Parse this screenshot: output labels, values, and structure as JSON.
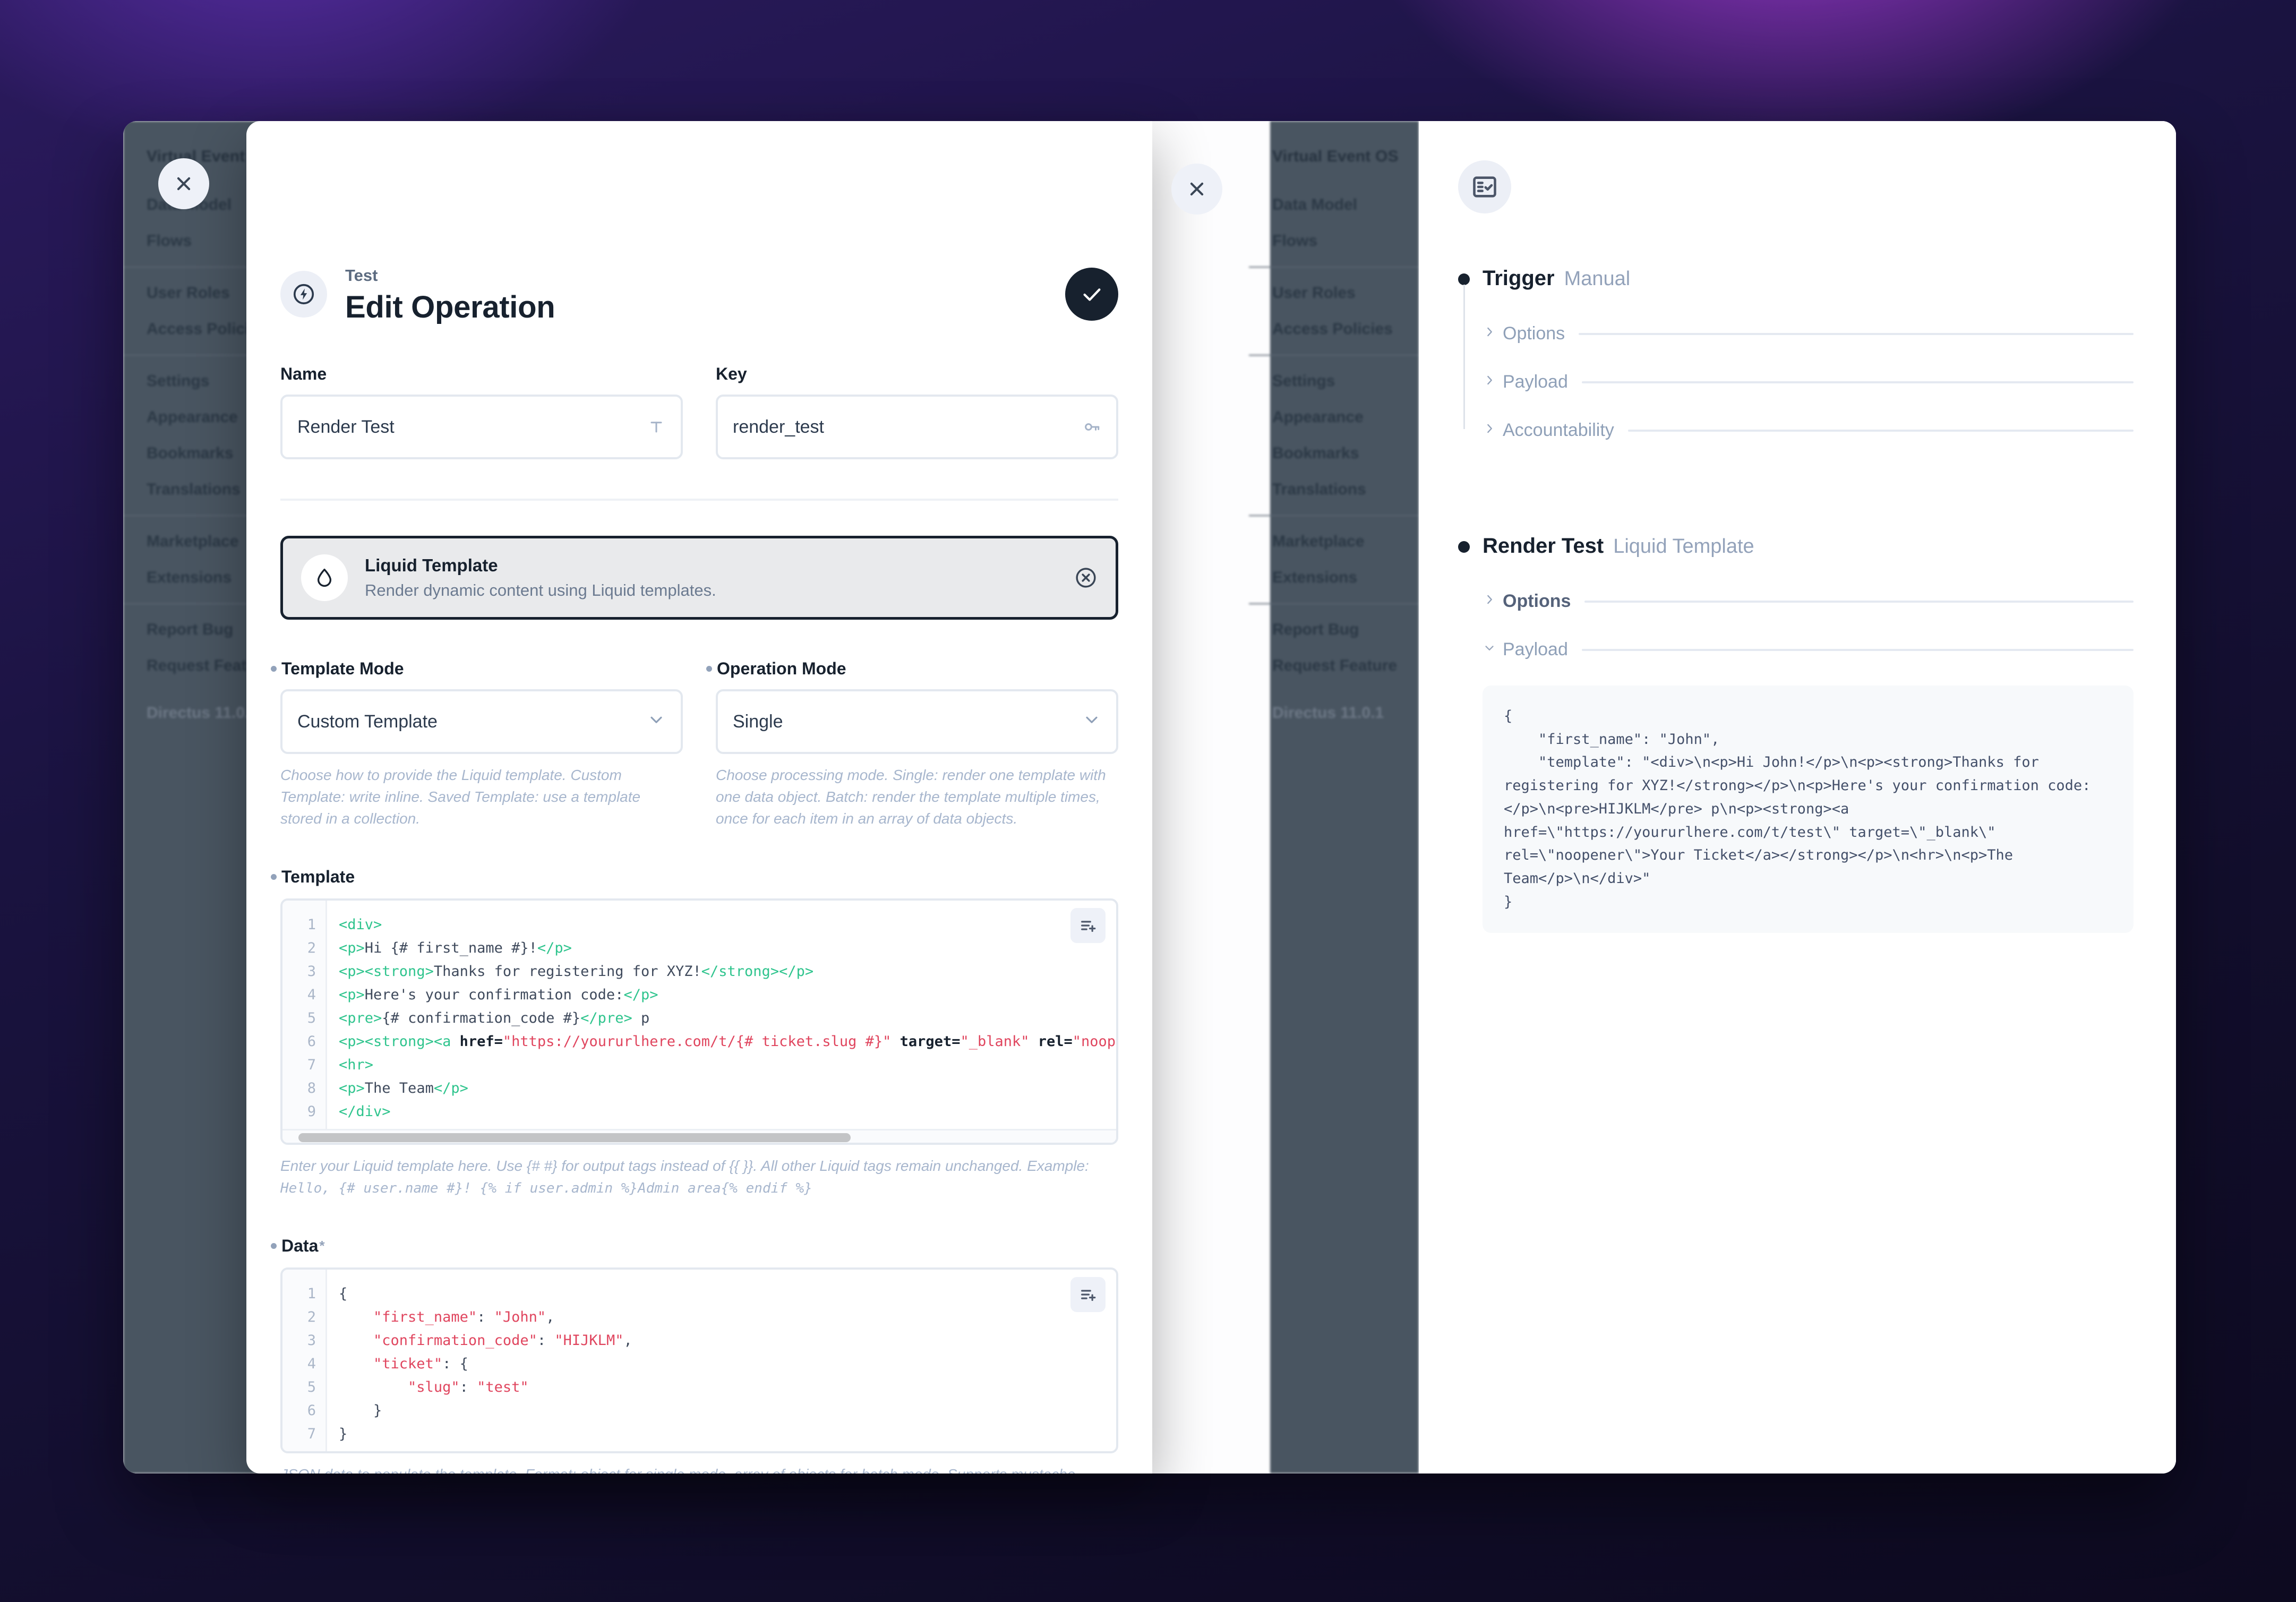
{
  "app": {
    "project_name": "Virtual Event OS",
    "version": "Directus 11.0.1",
    "sidebar_groups": [
      {
        "items": [
          "Data Model",
          "Flows"
        ]
      },
      {
        "items": [
          "User Roles",
          "Access Policies"
        ]
      },
      {
        "items": [
          "Settings",
          "Appearance",
          "Bookmarks",
          "Translations"
        ]
      },
      {
        "items": [
          "Marketplace",
          "Extensions"
        ]
      },
      {
        "items": [
          "Report Bug",
          "Request Feature"
        ]
      }
    ]
  },
  "modal": {
    "close_label": "×",
    "eyebrow": "Test",
    "title": "Edit Operation",
    "header_icon": "bolt-circle-icon",
    "save_label": "✓",
    "name": {
      "label": "Name",
      "value": "Render Test",
      "icon": "text-format-icon"
    },
    "key": {
      "label": "Key",
      "value": "render_test",
      "icon": "key-icon"
    },
    "operation_card": {
      "icon": "liquid-drop-icon",
      "name": "Liquid Template",
      "description": "Render dynamic content using Liquid templates.",
      "close_icon": "close-circle-icon"
    },
    "template_mode": {
      "label": "Template Mode",
      "value": "Custom Template",
      "help": "Choose how to provide the Liquid template. Custom Template: write inline. Saved Template: use a template stored in a collection."
    },
    "operation_mode": {
      "label": "Operation Mode",
      "value": "Single",
      "help": "Choose processing mode. Single: render one template with one data object. Batch: render the template multiple times, once for each item in an array of data objects."
    },
    "template": {
      "label": "Template",
      "help_prefix": "Enter your Liquid template here. Use {# #} for output tags instead of {{ }}. All other Liquid tags remain unchanged. Example: ",
      "help_code": "Hello, {# user.name #}! {% if user.admin %}Admin area{% endif %}",
      "insert_icon": "insert-field-icon",
      "lines": [
        {
          "n": 1,
          "text": "<div>"
        },
        {
          "n": 2,
          "text": "<p>Hi {# first_name #}!</p>"
        },
        {
          "n": 3,
          "text": "<p><strong>Thanks for registering for XYZ!</strong></p>"
        },
        {
          "n": 4,
          "text": "<p>Here's your confirmation code:</p>"
        },
        {
          "n": 5,
          "text": "<pre>{# confirmation_code #}</pre> p"
        },
        {
          "n": 6,
          "text": "<p><strong><a href=\"https://yoururlhere.com/t/{# ticket.slug #}\" target=\"_blank\" rel=\"noopener\">"
        },
        {
          "n": 7,
          "text": "<hr>"
        },
        {
          "n": 8,
          "text": "<p>The Team</p>"
        },
        {
          "n": 9,
          "text": "</div>"
        }
      ]
    },
    "data": {
      "label": "Data",
      "required_mark": "*",
      "insert_icon": "insert-field-icon",
      "help": "JSON data to populate the template. Format: object for single mode, array of objects for batch mode. Supports mustache syntax for dynamic values, e.g., {\"user\": \"{{$trigger.user}}\"}.",
      "lines": [
        {
          "n": 1,
          "text": "{"
        },
        {
          "n": 2,
          "text": "    \"first_name\": \"John\","
        },
        {
          "n": 3,
          "text": "    \"confirmation_code\": \"HIJKLM\","
        },
        {
          "n": 4,
          "text": "    \"ticket\": {"
        },
        {
          "n": 5,
          "text": "        \"slug\": \"test\""
        },
        {
          "n": 6,
          "text": "    }"
        },
        {
          "n": 7,
          "text": "}"
        }
      ]
    }
  },
  "inspector": {
    "panel_icon": "fact-check-icon",
    "nodes": [
      {
        "title": "Trigger",
        "subtitle": "Manual",
        "sections": [
          {
            "label": "Options",
            "open": false,
            "strong": false
          },
          {
            "label": "Payload",
            "open": false,
            "strong": false
          },
          {
            "label": "Accountability",
            "open": false,
            "strong": false
          }
        ]
      },
      {
        "title": "Render Test",
        "subtitle": "Liquid Template",
        "sections": [
          {
            "label": "Options",
            "open": false,
            "strong": true
          },
          {
            "label": "Payload",
            "open": true,
            "strong": false
          }
        ],
        "payload": "{\n    \"first_name\": \"John\",\n    \"template\": \"<div>\\n<p>Hi John!</p>\\n<p><strong>Thanks for registering for XYZ!</strong></p>\\n<p>Here's your confirmation code:</p>\\n<pre>HIJKLM</pre> p\\n<p><strong><a href=\\\"https://yoururlhere.com/t/test\\\" target=\\\"_blank\\\" rel=\\\"noopener\\\">Your Ticket</a></strong></p>\\n<hr>\\n<p>The Team</p>\\n</div>\"\n}"
      }
    ]
  },
  "colors": {
    "accent": "#17212e",
    "muted": "#93a2ba",
    "tag": "#2ec48d",
    "string": "#e0455e"
  }
}
